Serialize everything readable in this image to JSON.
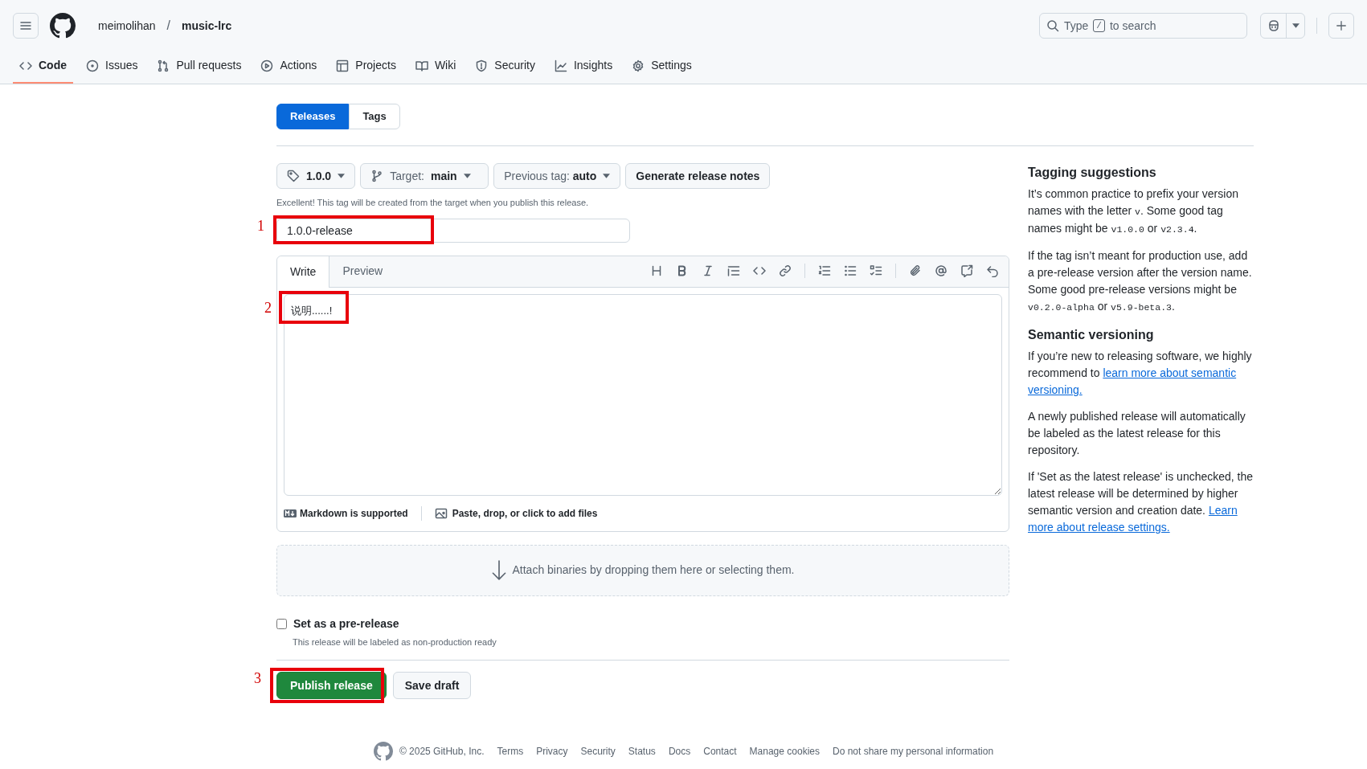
{
  "header": {
    "owner": "meimolihan",
    "separator": "/",
    "repo": "music-lrc",
    "search_placeholder_before": "Type",
    "search_key": "/",
    "search_placeholder_after": "to search"
  },
  "repo_tabs": [
    {
      "label": "Code",
      "selected": true
    },
    {
      "label": "Issues",
      "selected": false
    },
    {
      "label": "Pull requests",
      "selected": false
    },
    {
      "label": "Actions",
      "selected": false
    },
    {
      "label": "Projects",
      "selected": false
    },
    {
      "label": "Wiki",
      "selected": false
    },
    {
      "label": "Security",
      "selected": false
    },
    {
      "label": "Insights",
      "selected": false
    },
    {
      "label": "Settings",
      "selected": false
    }
  ],
  "subnav": [
    {
      "label": "Releases",
      "selected": true
    },
    {
      "label": "Tags",
      "selected": false
    }
  ],
  "tag_row": {
    "tag": "1.0.0",
    "target_label": "Target:",
    "target": "main",
    "previous_label": "Previous tag:",
    "previous": "auto",
    "generate": "Generate release notes"
  },
  "tag_hint": "Excellent! This tag will be created from the target when you publish this release.",
  "title_field": {
    "value": "1.0.0-release",
    "annotation": "1"
  },
  "editor": {
    "tabs": [
      {
        "label": "Write",
        "selected": true
      },
      {
        "label": "Preview",
        "selected": false
      }
    ],
    "value": "说明......!",
    "annotation": "2",
    "markdown_note": "Markdown is supported",
    "files_note": "Paste, drop, or click to add files"
  },
  "attach": "Attach binaries by dropping them here or selecting them.",
  "prerelease": {
    "label": "Set as a pre-release",
    "checked": false,
    "hint": "This release will be labeled as non-production ready"
  },
  "actions": {
    "publish": "Publish release",
    "annotation": "3",
    "draft": "Save draft"
  },
  "sidebar": [
    {
      "heading": "Tagging suggestions",
      "paragraphs": [
        [
          {
            "kind": "text",
            "text": "It’s common practice to prefix your version names with the letter "
          },
          {
            "kind": "code",
            "text": "v"
          },
          {
            "kind": "text",
            "text": ". Some good tag names might be "
          },
          {
            "kind": "code",
            "text": "v1.0.0"
          },
          {
            "kind": "text",
            "text": " or "
          },
          {
            "kind": "code",
            "text": "v2.3.4"
          },
          {
            "kind": "text",
            "text": "."
          }
        ],
        [
          {
            "kind": "text",
            "text": "If the tag isn’t meant for production use, add a pre-release version after the version name. Some good pre-release versions might be "
          },
          {
            "kind": "code",
            "text": "v0.2.0-alpha"
          },
          {
            "kind": "text",
            "text": " or "
          },
          {
            "kind": "code",
            "text": "v5.9-beta.3"
          },
          {
            "kind": "text",
            "text": "."
          }
        ]
      ]
    },
    {
      "heading": "Semantic versioning",
      "paragraphs": [
        [
          {
            "kind": "text",
            "text": "If you’re new to releasing software, we highly recommend to "
          },
          {
            "kind": "link",
            "text": "learn more about semantic"
          },
          {
            "kind": "link",
            "text": "versioning."
          }
        ],
        [
          {
            "kind": "text",
            "text": "A newly published release will automatically be labeled as the latest release for this repository."
          }
        ],
        [
          {
            "kind": "text",
            "text": "If 'Set as the latest release' is unchecked, the latest release will be determined by higher semantic version and creation date. "
          },
          {
            "kind": "link",
            "text": "Learn"
          },
          {
            "kind": "link",
            "text": "more about release settings."
          }
        ]
      ]
    }
  ],
  "footer": {
    "copyright": "© 2025 GitHub, Inc.",
    "links": [
      "Terms",
      "Privacy",
      "Security",
      "Status",
      "Docs",
      "Contact",
      "Manage cookies",
      "Do not share my personal information"
    ]
  }
}
